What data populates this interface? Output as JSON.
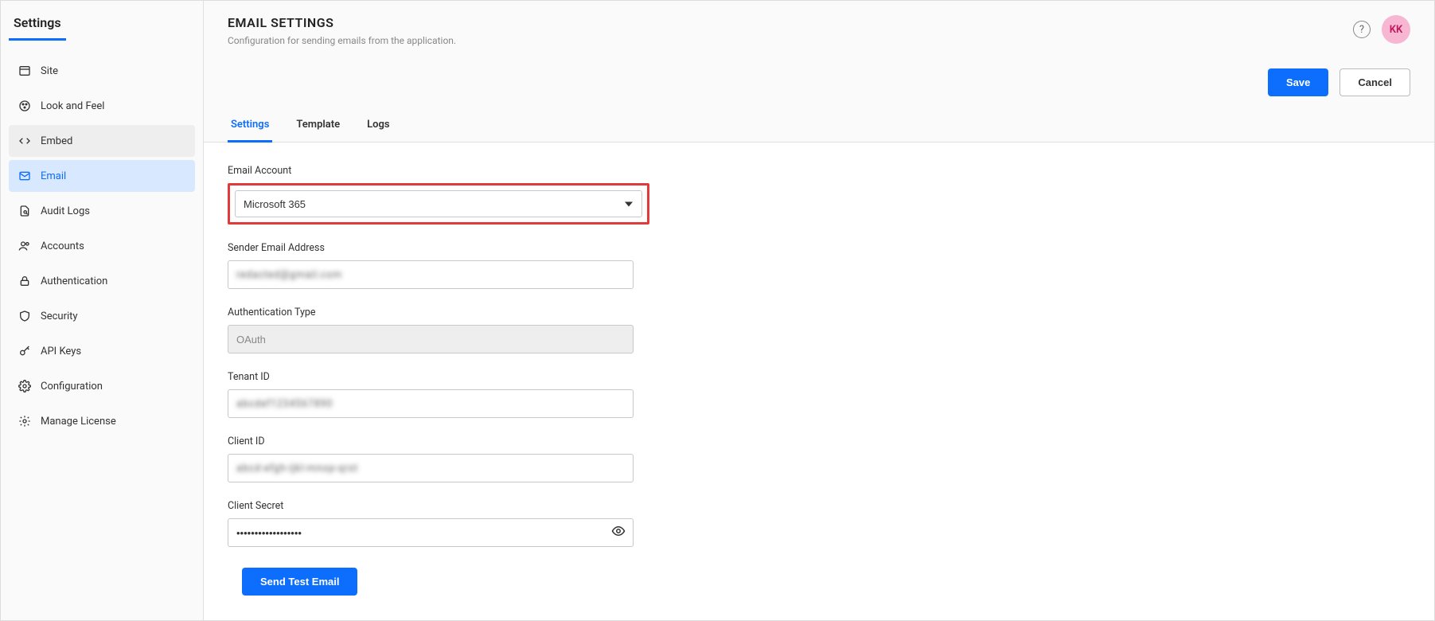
{
  "sidebar": {
    "title": "Settings",
    "items": [
      {
        "label": "Site"
      },
      {
        "label": "Look and Feel"
      },
      {
        "label": "Embed"
      },
      {
        "label": "Email"
      },
      {
        "label": "Audit Logs"
      },
      {
        "label": "Accounts"
      },
      {
        "label": "Authentication"
      },
      {
        "label": "Security"
      },
      {
        "label": "API Keys"
      },
      {
        "label": "Configuration"
      },
      {
        "label": "Manage License"
      }
    ]
  },
  "header": {
    "title": "EMAIL SETTINGS",
    "subtitle": "Configuration for sending emails from the application.",
    "avatar_initials": "KK",
    "save_label": "Save",
    "cancel_label": "Cancel"
  },
  "tabs": [
    {
      "label": "Settings"
    },
    {
      "label": "Template"
    },
    {
      "label": "Logs"
    }
  ],
  "form": {
    "email_account_label": "Email Account",
    "email_account_value": "Microsoft 365",
    "sender_label": "Sender Email Address",
    "sender_value": "redacted@gmail.com",
    "auth_type_label": "Authentication Type",
    "auth_type_value": "OAuth",
    "tenant_label": "Tenant ID",
    "tenant_value": "abcdef1234567890",
    "client_id_label": "Client ID",
    "client_id_value": "abcd-efgh-ijkl-mnop-qrst",
    "client_secret_label": "Client Secret",
    "client_secret_value": "••••••••••••••••••",
    "send_test_label": "Send Test Email"
  }
}
